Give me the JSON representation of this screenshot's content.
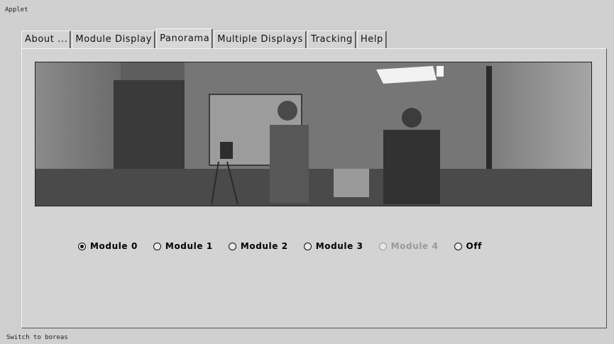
{
  "window": {
    "title": "Applet"
  },
  "tabs": [
    {
      "label": "About ..."
    },
    {
      "label": "Module Display"
    },
    {
      "label": "Panorama"
    },
    {
      "label": "Multiple Displays"
    },
    {
      "label": "Tracking"
    },
    {
      "label": "Help"
    }
  ],
  "active_tab": "Panorama",
  "panorama": {
    "description_icon": "panoramic-camera-image"
  },
  "modules": [
    {
      "label": "Module 0",
      "checked": true,
      "enabled": true
    },
    {
      "label": "Module 1",
      "checked": false,
      "enabled": true
    },
    {
      "label": "Module 2",
      "checked": false,
      "enabled": true
    },
    {
      "label": "Module 3",
      "checked": false,
      "enabled": true
    },
    {
      "label": "Module 4",
      "checked": false,
      "enabled": false
    },
    {
      "label": "Off",
      "checked": false,
      "enabled": true
    }
  ],
  "status": {
    "text": "Switch to boreas"
  }
}
